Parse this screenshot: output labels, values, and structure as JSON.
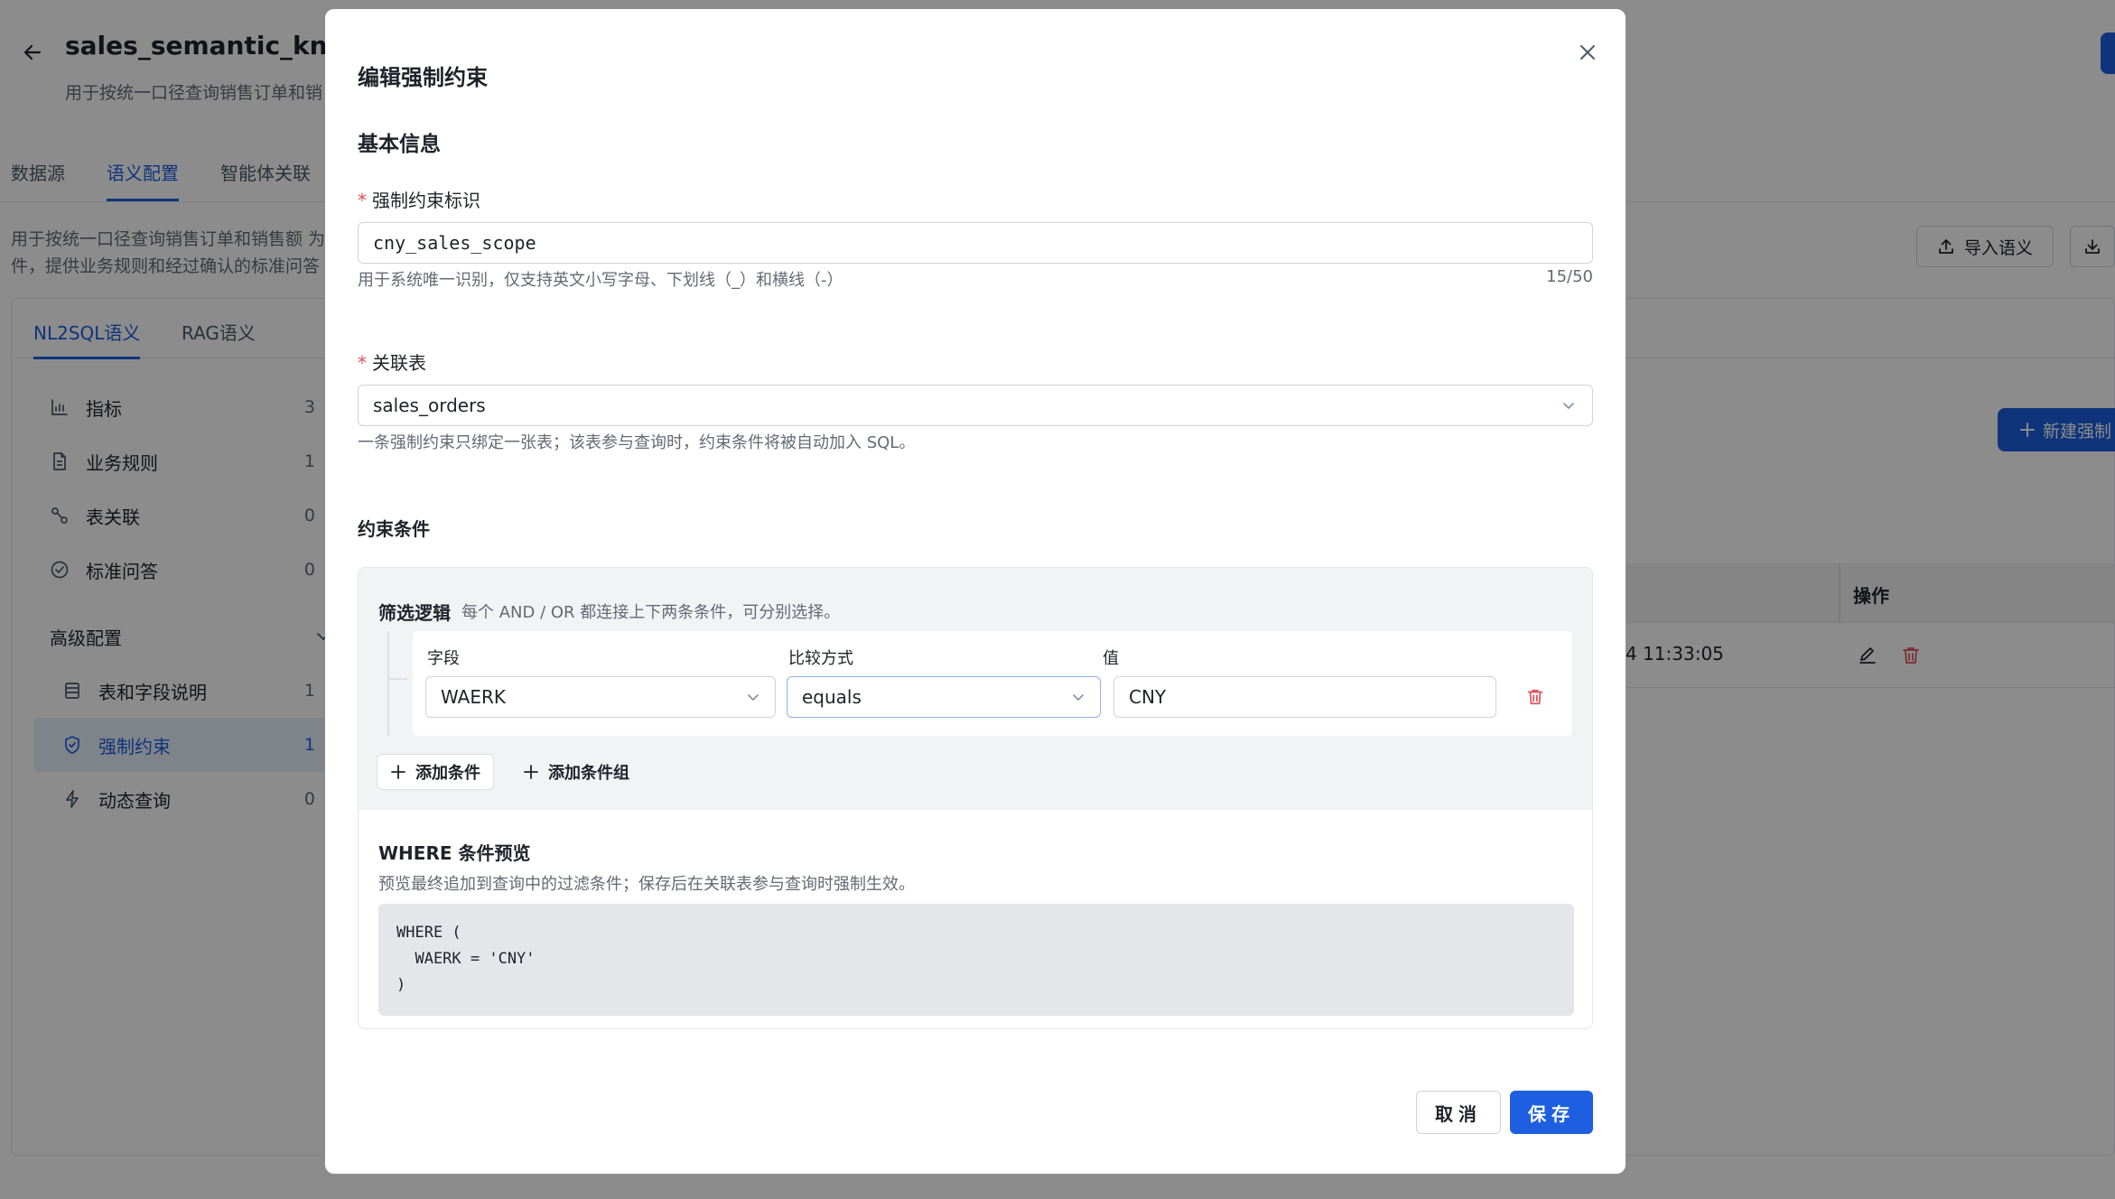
{
  "background": {
    "title": "sales_semantic_knowle",
    "subtitle": "用于按统一口径查询销售订单和销",
    "tabs": [
      "数据源",
      "语义配置",
      "智能体关联"
    ],
    "active_tab": "语义配置",
    "description": "用于按统一口径查询销售订单和销售额 为 件，提供业务规则和经过确认的标准问答",
    "import_button": "导入语义",
    "subtabs": [
      "NL2SQL语义",
      "RAG语义"
    ],
    "sidebar": {
      "items": [
        {
          "label": "指标",
          "count": "3"
        },
        {
          "label": "业务规则",
          "count": "1"
        },
        {
          "label": "表关联",
          "count": "0"
        },
        {
          "label": "标准问答",
          "count": "0"
        }
      ],
      "group_label": "高级配置",
      "group_items": [
        {
          "label": "表和字段说明",
          "count": "1"
        },
        {
          "label": "强制约束",
          "count": "1"
        },
        {
          "label": "动态查询",
          "count": "0"
        }
      ]
    },
    "new_button": "新建强制",
    "table_header_ops": "操作",
    "row_time": "4 11:33:05"
  },
  "modal": {
    "title": "编辑强制约束",
    "section_basic": "基本信息",
    "identifier": {
      "label": "强制约束标识",
      "required_mark": "*",
      "value": "cny_sales_scope",
      "hint": "用于系统唯一识别，仅支持英文小写字母、下划线（_）和横线（-）",
      "count": "15/50"
    },
    "table": {
      "label": "关联表",
      "required_mark": "*",
      "value": "sales_orders",
      "hint": "一条强制约束只绑定一张表；该表参与查询时，约束条件将被自动加入 SQL。"
    },
    "section_conditions": "约束条件",
    "logic": {
      "title": "筛选逻辑",
      "hint": "每个 AND / OR 都连接上下两条条件，可分别选择。"
    },
    "condition": {
      "field_label": "字段",
      "field_value": "WAERK",
      "op_label": "比较方式",
      "op_value": "equals",
      "value_label": "值",
      "value_value": "CNY"
    },
    "add_condition": "添加条件",
    "add_group": "添加条件组",
    "preview": {
      "title": "WHERE 条件预览",
      "hint": "预览最终追加到查询中的过滤条件；保存后在关联表参与查询时强制生效。",
      "code": "WHERE (\n  WAERK = 'CNY'\n)"
    },
    "cancel": "取消",
    "save": "保存"
  },
  "colors": {
    "primary": "#1d5fe0",
    "danger": "#e34d59",
    "overlay": "rgba(0,0,0,0.45)"
  }
}
